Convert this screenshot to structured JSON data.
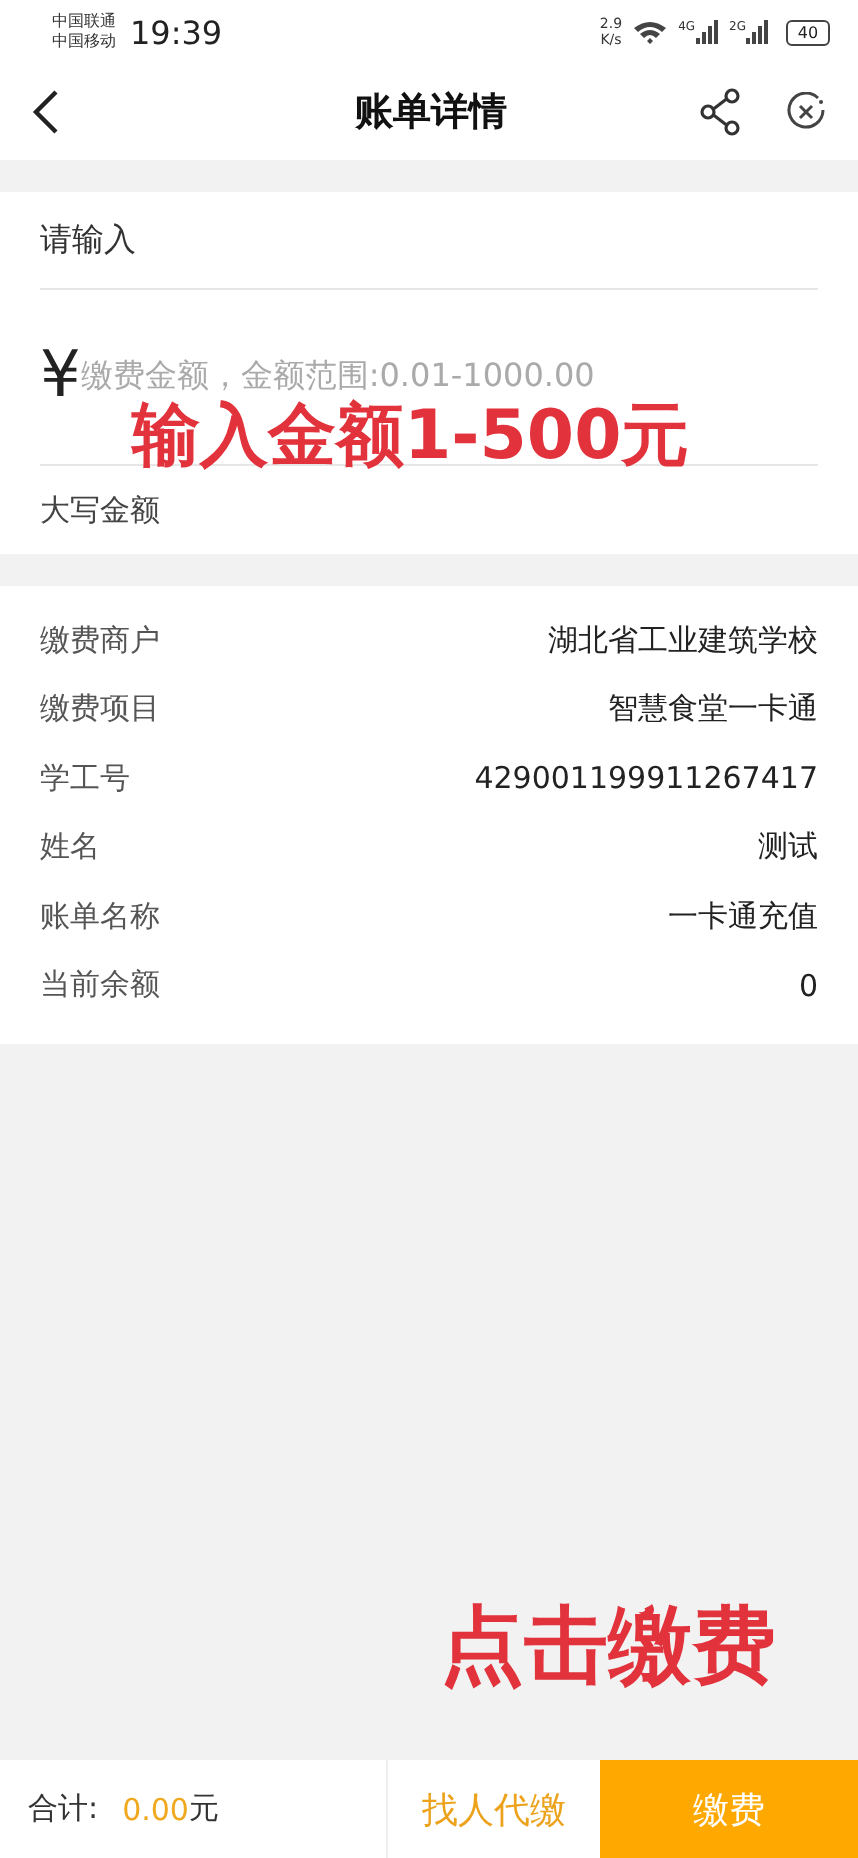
{
  "status_bar": {
    "carriers": [
      "中国联通",
      "中国移动"
    ],
    "time": "19:39",
    "speed": [
      "2.9",
      "K/s"
    ],
    "networks": [
      "4G",
      "2G"
    ],
    "battery": "40"
  },
  "header": {
    "title": "账单详情"
  },
  "input_section": {
    "label": "请输入",
    "currency": "¥",
    "amount": {
      "placeholder": "缴费金额，金额范围:0.01-1000.00"
    },
    "uppercase_label": "大写金额"
  },
  "details": [
    {
      "label": "缴费商户",
      "value": "湖北省工业建筑学校"
    },
    {
      "label": "缴费项目",
      "value": "智慧食堂一卡通"
    },
    {
      "label": "学工号",
      "value": "429001199911267417"
    },
    {
      "label": "姓名",
      "value": "测试"
    },
    {
      "label": "账单名称",
      "value": "一卡通充值"
    },
    {
      "label": "当前余额",
      "value": "0"
    }
  ],
  "annotations": [
    {
      "kind": "amount",
      "text": "输入金额1-500元"
    },
    {
      "kind": "pay",
      "text": "点击缴费"
    }
  ],
  "footer": {
    "total_label": "合计:",
    "total_amount": "0.00",
    "total_unit": "元",
    "proxy_button": "找人代缴",
    "pay_button": "缴费"
  }
}
